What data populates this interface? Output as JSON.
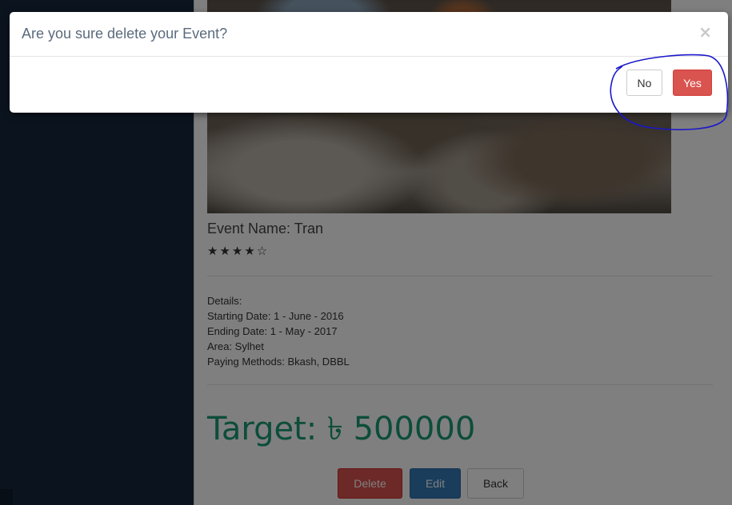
{
  "event": {
    "name": "Event Name: Tran",
    "stars": "★★★★☆",
    "rating": 4,
    "details": {
      "heading": "Details:",
      "starting_date": "Starting Date: 1 - June - 2016",
      "ending_date": "Ending Date: 1 - May - 2017",
      "area": "Area: Sylhet",
      "paying_methods": "Paying Methods: Bkash, DBBL"
    },
    "target": "Target: ৳ 500000"
  },
  "actions": {
    "delete_label": "Delete",
    "edit_label": "Edit",
    "back_label": "Back"
  },
  "modal": {
    "title": "Are you sure delete your Event?",
    "close_label": "×",
    "no_label": "No",
    "yes_label": "Yes"
  },
  "colors": {
    "danger": "#d9534f",
    "primary": "#337ab7",
    "target_green": "#1b9b74",
    "sidebar": "#16293d",
    "annotation": "#1a17c9"
  },
  "icons": {
    "close": "close-icon",
    "stars": "star-icon"
  }
}
